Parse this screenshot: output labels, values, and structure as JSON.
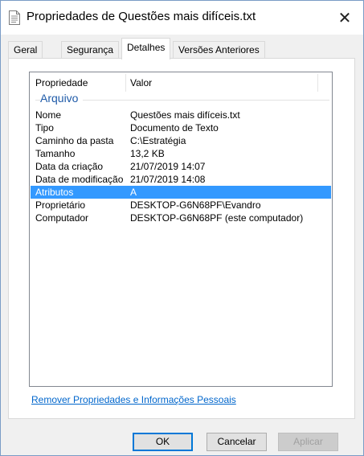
{
  "window": {
    "title": "Propriedades de Questões mais difíceis.txt",
    "close_label": "✕"
  },
  "tabs": [
    {
      "label": "Geral",
      "active": false
    },
    {
      "label": "Segurança",
      "active": false
    },
    {
      "label": "Detalhes",
      "active": true
    },
    {
      "label": "Versões Anteriores",
      "active": false
    }
  ],
  "list": {
    "columns": {
      "property": "Propriedade",
      "value": "Valor"
    },
    "group": "Arquivo",
    "rows": [
      {
        "k": "Nome",
        "v": "Questões mais difíceis.txt"
      },
      {
        "k": "Tipo",
        "v": "Documento de Texto"
      },
      {
        "k": "Caminho da pasta",
        "v": "C:\\Estratégia"
      },
      {
        "k": "Tamanho",
        "v": "13,2 KB"
      },
      {
        "k": "Data da criação",
        "v": "21/07/2019 14:07"
      },
      {
        "k": "Data de modificação",
        "v": "21/07/2019 14:08"
      },
      {
        "k": "Atributos",
        "v": "A",
        "selected": true
      },
      {
        "k": "Proprietário",
        "v": "DESKTOP-G6N68PF\\Evandro"
      },
      {
        "k": "Computador",
        "v": "DESKTOP-G6N68PF (este computador)"
      }
    ]
  },
  "link": {
    "label": "Remover Propriedades e Informações Pessoais"
  },
  "buttons": {
    "ok": "OK",
    "cancel": "Cancelar",
    "apply": "Aplicar"
  },
  "colors": {
    "selection": "#3399ff",
    "group_label": "#1e5aa8",
    "link": "#0066cc"
  }
}
